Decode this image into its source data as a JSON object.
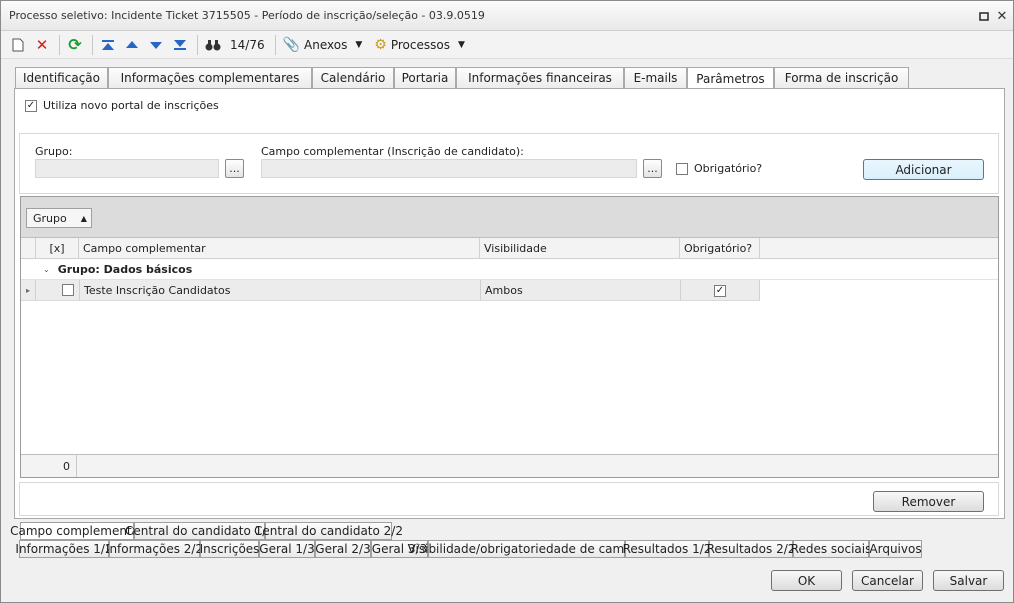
{
  "window": {
    "title": "Processo seletivo: Incidente Ticket 3715505 - Período de inscrição/seleção - 03.9.0519"
  },
  "toolbar": {
    "record_counter": "14/76",
    "anexos_label": "Anexos",
    "processos_label": "Processos"
  },
  "tabs": [
    {
      "label": "Identificação"
    },
    {
      "label": "Informações complementares"
    },
    {
      "label": "Calendário"
    },
    {
      "label": "Portaria"
    },
    {
      "label": "Informações financeiras"
    },
    {
      "label": "E-mails"
    },
    {
      "label": "Parâmetros",
      "active": true
    },
    {
      "label": "Forma de inscrição"
    }
  ],
  "params": {
    "use_new_portal_label": "Utiliza novo portal de inscrições",
    "use_new_portal_checked": true
  },
  "form": {
    "grupo_label": "Grupo:",
    "campo_label": "Campo complementar (Inscrição de candidato):",
    "obrigatorio_label": "Obrigatório?",
    "add_button": "Adicionar"
  },
  "grid": {
    "group_by_chip": "Grupo",
    "columns": {
      "check": "[x]",
      "campo": "Campo complementar",
      "visibilidade": "Visibilidade",
      "obrigatorio": "Obrigatório?"
    },
    "group_row": "Grupo: Dados básicos",
    "rows": [
      {
        "campo": "Teste Inscrição Candidatos",
        "visibilidade": "Ambos",
        "obrigatorio": true
      }
    ],
    "footer_count": "0"
  },
  "remove_button": "Remover",
  "subtabs_row1": [
    {
      "label": "Campo complementar",
      "active": true
    },
    {
      "label": "Central do candidato 1/2"
    },
    {
      "label": "Central do candidato 2/2"
    }
  ],
  "subtabs_row2": [
    {
      "label": "Informações 1/2"
    },
    {
      "label": "Informações 2/2"
    },
    {
      "label": "Inscrições"
    },
    {
      "label": "Geral 1/3"
    },
    {
      "label": "Geral 2/3"
    },
    {
      "label": "Geral 3/3"
    },
    {
      "label": "Visibilidade/obrigatoriedade de campos"
    },
    {
      "label": "Resultados 1/2"
    },
    {
      "label": "Resultados 2/2"
    },
    {
      "label": "Redes sociais"
    },
    {
      "label": "Arquivos"
    }
  ],
  "footer": {
    "ok": "OK",
    "cancel": "Cancelar",
    "save": "Salvar"
  }
}
